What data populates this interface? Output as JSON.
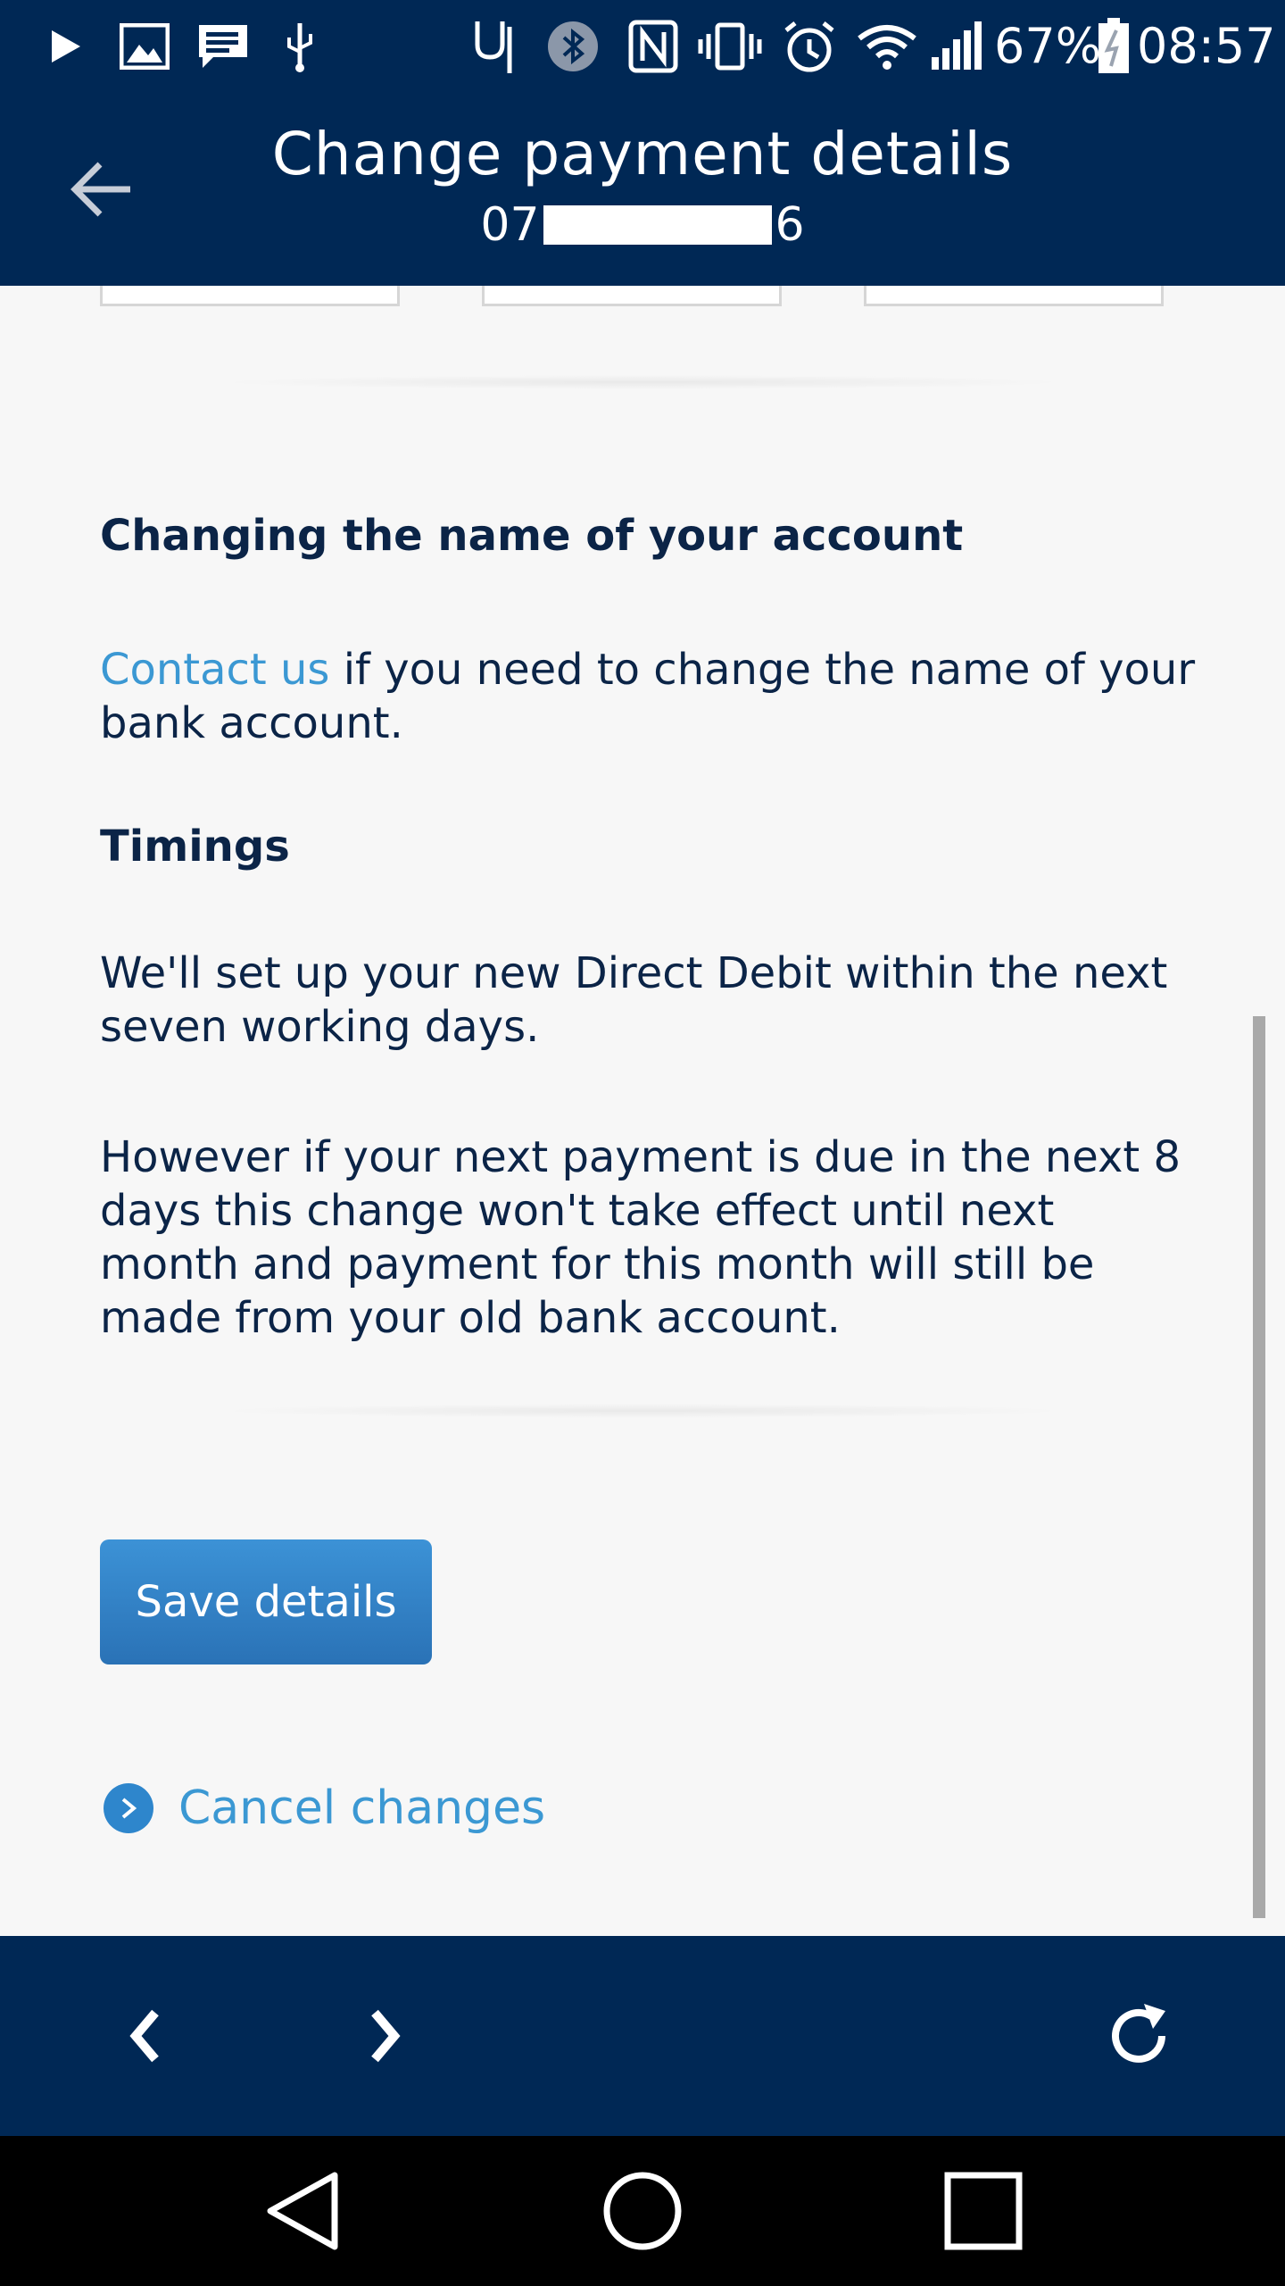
{
  "status_bar": {
    "battery_percent": "67%",
    "time": "08:57"
  },
  "header": {
    "title": "Change payment details",
    "account_prefix": "07",
    "account_suffix": "6"
  },
  "content": {
    "name_heading": "Changing the name of your account",
    "contact_link": "Contact us",
    "contact_text": " if you need to change the name of your bank account.",
    "timings_heading": "Timings",
    "timings_text_1": "We'll set up your new Direct Debit within the next seven working days.",
    "timings_text_2": "However if your next payment is due in the next 8 days this change won't take effect until next month and payment for this month will still be made from your old bank account."
  },
  "actions": {
    "save_label": "Save details",
    "cancel_label": "Cancel changes"
  },
  "colors": {
    "header_bg": "#002855",
    "text_primary": "#0b2447",
    "link": "#3b98d3",
    "button": "#2e86cc"
  }
}
